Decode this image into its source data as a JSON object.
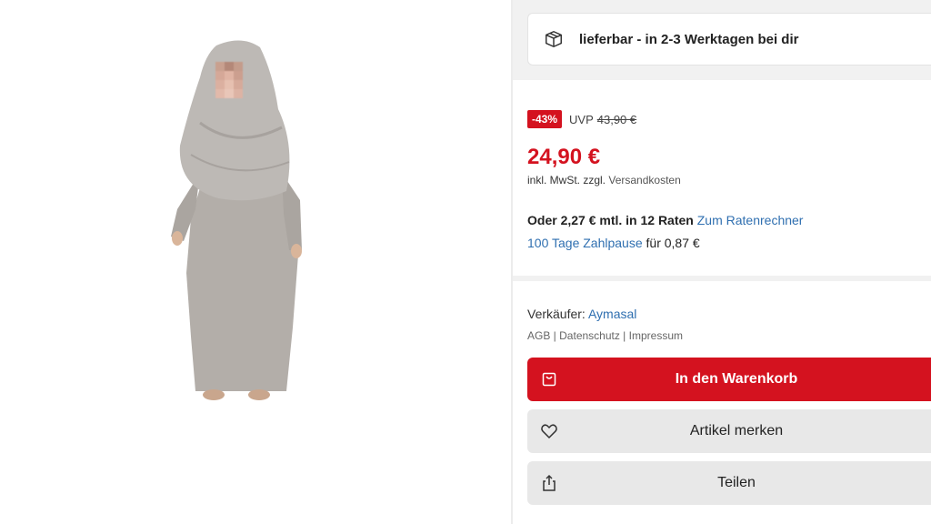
{
  "delivery": {
    "icon": "package-icon",
    "text": "lieferbar - in 2-3 Werktagen bei dir"
  },
  "price": {
    "discount": "-43%",
    "uvp_label": "UVP",
    "uvp_price": "43,90 €",
    "current": "24,90 €",
    "tax_prefix": "inkl. MwSt. zzgl.",
    "tax_link": "Versandkosten",
    "installment_text": "Oder 2,27 € mtl. in 12 Raten",
    "installment_link": "Zum Ratenrechner",
    "pause_link": "100 Tage Zahlpause",
    "pause_suffix": "für 0,87 €"
  },
  "seller": {
    "label": "Verkäufer:",
    "name": "Aymasal",
    "legal_agb": "AGB",
    "legal_datenschutz": "Datenschutz",
    "legal_impressum": "Impressum",
    "separator": " | "
  },
  "actions": {
    "cart_label": "In den Warenkorb",
    "watch_label": "Artikel merken",
    "share_label": "Teilen"
  },
  "colors": {
    "accent": "#d4121f",
    "link": "#2f6fb0"
  }
}
